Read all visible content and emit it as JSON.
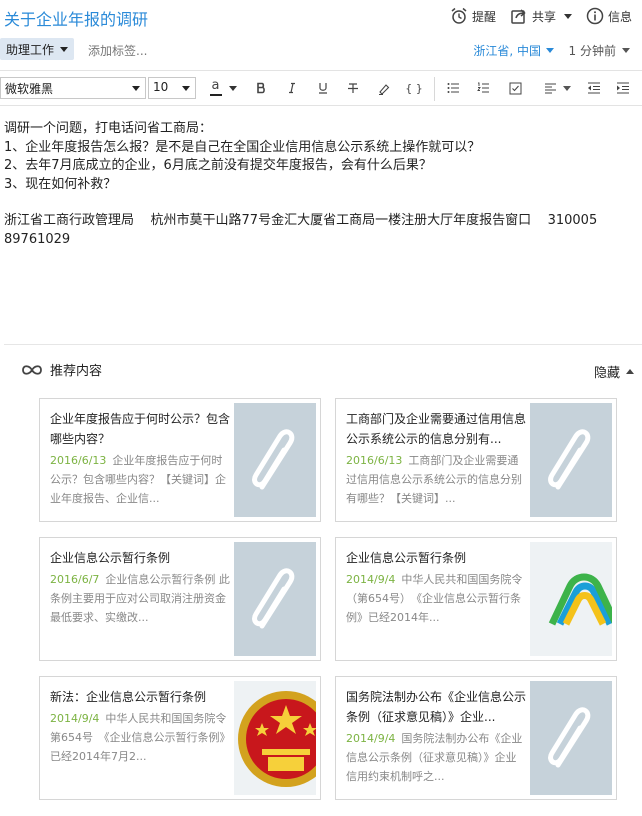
{
  "header": {
    "title": "关于企业年报的调研",
    "remind_label": "提醒",
    "share_label": "共享",
    "info_label": "信息"
  },
  "tagbar": {
    "notebook_label": "助理工作",
    "add_tag_placeholder": "添加标签...",
    "location": "浙江省, 中国",
    "time": "1 分钟前"
  },
  "toolbar": {
    "font": "微软雅黑",
    "size": "10",
    "text_color_glyph": "a"
  },
  "content": {
    "lines": [
      "调研一个问题，打电话问省工商局：",
      "1、企业年度报告怎么报？是不是自己在全国企业信用信息公示系统上操作就可以？",
      "2、去年7月底成立的企业，6月底之前没有提交年度报告，会有什么后果？",
      "3、现在如何补救？",
      "",
      "浙江省工商行政管理局    杭州市莫干山路77号金汇大厦省工商局一楼注册大厅年度报告窗口    310005",
      "89761029"
    ]
  },
  "recommend": {
    "title": "推荐内容",
    "hide_label": "隐藏",
    "cards": [
      {
        "title": "企业年度报告应于何时公示？包含哪些内容？",
        "date": "2016/6/13",
        "snippet": "企业年度报告应于何时公示？包含哪些内容？【关键词】企业年度报告、企业信...",
        "thumb": "paperclip-icon"
      },
      {
        "title": "工商部门及企业需要通过信用信息公示系统公示的信息分别有...",
        "date": "2016/6/13",
        "snippet": "工商部门及企业需要通过信用信息公示系统公示的信息分别有哪些？【关键词】...",
        "thumb": "paperclip-icon"
      },
      {
        "title": "企业信息公示暂行条例",
        "date": "2016/6/7",
        "snippet": "企业信息公示暂行条例 此条例主要用于应对公司取消注册资金最低要求、实缴改...",
        "thumb": "paperclip-icon"
      },
      {
        "title": "企业信息公示暂行条例",
        "date": "2014/9/4",
        "snippet": "中华人民共和国国务院令（第654号）　《企业信息公示暂行条例》已经2014年...",
        "thumb": "rainbow-logo"
      },
      {
        "title": "新法：企业信息公示暂行条例",
        "date": "2014/9/4",
        "snippet": "中华人民共和国国务院令第654号　《企业信息公示暂行条例》已经2014年7月2...",
        "thumb": "national-emblem"
      },
      {
        "title": "国务院法制办公布《企业信息公示条例（征求意见稿）》企业...",
        "date": "2014/9/4",
        "snippet": "国务院法制办公布《企业信息公示条例（征求意见稿）》企业信用约束机制呼之...",
        "thumb": "paperclip-icon"
      }
    ]
  },
  "colors": {
    "accent": "#2a8ad8",
    "date_green": "#7cb342",
    "thumb_gray": "#c6d2da"
  }
}
